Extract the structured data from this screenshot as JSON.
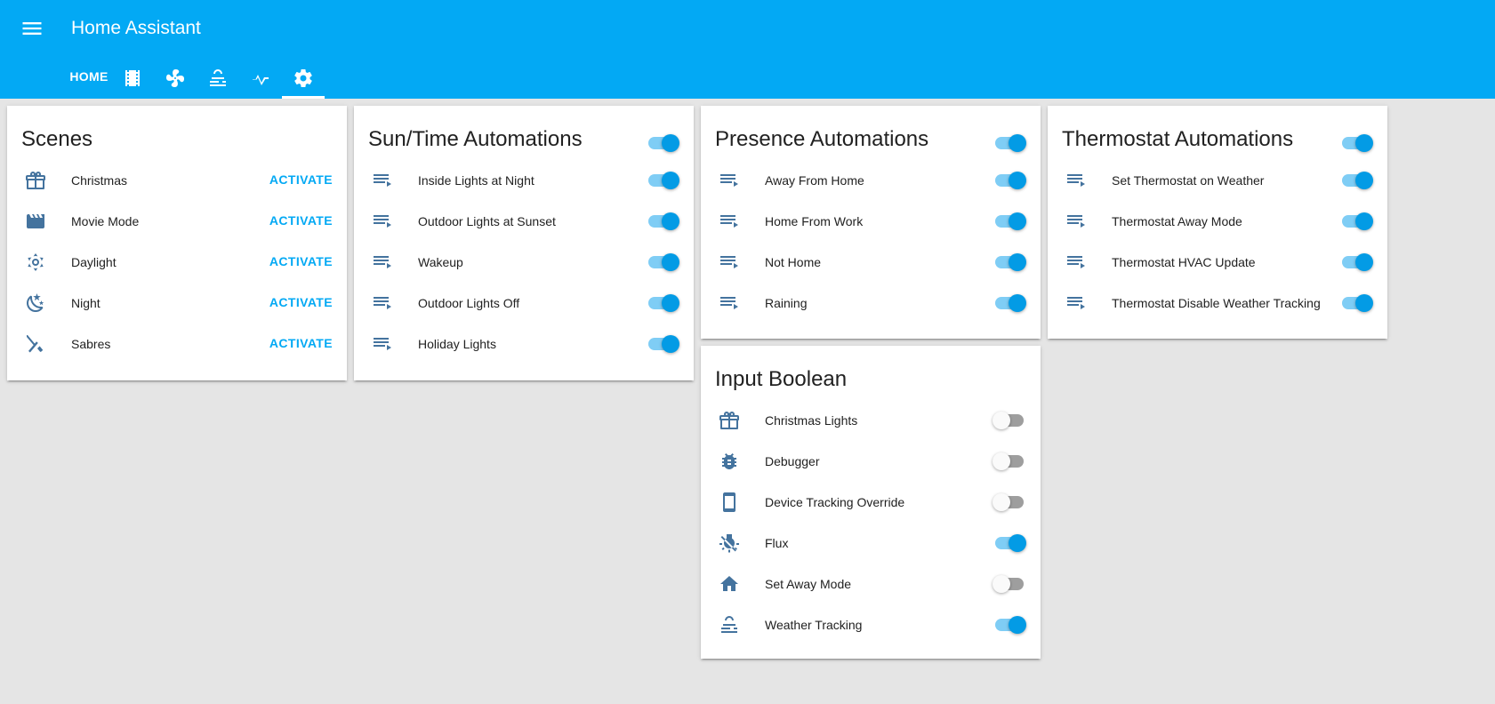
{
  "app": {
    "title": "Home Assistant"
  },
  "tabs": [
    {
      "label": "HOME",
      "icon": "home-text"
    },
    {
      "icon": "film-icon"
    },
    {
      "icon": "fan-icon"
    },
    {
      "icon": "weather-fog-icon"
    },
    {
      "icon": "pulse-icon"
    },
    {
      "icon": "settings-icon",
      "active": true
    }
  ],
  "colors": {
    "primary": "#03a9f4",
    "icon": "#44739e",
    "toggle_on": "#039be5",
    "background": "#e5e5e5"
  },
  "cards": {
    "scenes": {
      "title": "Scenes",
      "items": [
        {
          "label": "Christmas",
          "icon": "gift-icon",
          "action": "ACTIVATE"
        },
        {
          "label": "Movie Mode",
          "icon": "movie-clapper-icon",
          "action": "ACTIVATE"
        },
        {
          "label": "Daylight",
          "icon": "sun-icon",
          "action": "ACTIVATE"
        },
        {
          "label": "Night",
          "icon": "moon-stars-icon",
          "action": "ACTIVATE"
        },
        {
          "label": "Sabres",
          "icon": "hockey-sticks-icon",
          "action": "ACTIVATE"
        }
      ]
    },
    "sun_time": {
      "title": "Sun/Time Automations",
      "toggle_on": true,
      "items": [
        {
          "label": "Inside Lights at Night",
          "icon": "playlist-play-icon",
          "on": true
        },
        {
          "label": "Outdoor Lights at Sunset",
          "icon": "playlist-play-icon",
          "on": true
        },
        {
          "label": "Wakeup",
          "icon": "playlist-play-icon",
          "on": true
        },
        {
          "label": "Outdoor Lights Off",
          "icon": "playlist-play-icon",
          "on": true
        },
        {
          "label": "Holiday Lights",
          "icon": "playlist-play-icon",
          "on": true
        }
      ]
    },
    "presence": {
      "title": "Presence Automations",
      "toggle_on": true,
      "items": [
        {
          "label": "Away From Home",
          "icon": "playlist-play-icon",
          "on": true
        },
        {
          "label": "Home From Work",
          "icon": "playlist-play-icon",
          "on": true
        },
        {
          "label": "Not Home",
          "icon": "playlist-play-icon",
          "on": true
        },
        {
          "label": "Raining",
          "icon": "playlist-play-icon",
          "on": true
        }
      ]
    },
    "thermostat": {
      "title": "Thermostat Automations",
      "toggle_on": true,
      "items": [
        {
          "label": "Set Thermostat on Weather",
          "icon": "playlist-play-icon",
          "on": true
        },
        {
          "label": "Thermostat Away Mode",
          "icon": "playlist-play-icon",
          "on": true
        },
        {
          "label": "Thermostat HVAC Update",
          "icon": "playlist-play-icon",
          "on": true
        },
        {
          "label": "Thermostat Disable Weather Tracking",
          "icon": "playlist-play-icon",
          "on": true
        }
      ]
    },
    "input_boolean": {
      "title": "Input Boolean",
      "items": [
        {
          "label": "Christmas Lights",
          "icon": "gift-icon",
          "on": false
        },
        {
          "label": "Debugger",
          "icon": "bug-icon",
          "on": false
        },
        {
          "label": "Device Tracking Override",
          "icon": "cellphone-icon",
          "on": false
        },
        {
          "label": "Flux",
          "icon": "weather-sunset-icon",
          "on": true
        },
        {
          "label": "Set Away Mode",
          "icon": "home-icon",
          "on": false
        },
        {
          "label": "Weather Tracking",
          "icon": "weather-fog-icon",
          "on": true
        }
      ]
    }
  }
}
